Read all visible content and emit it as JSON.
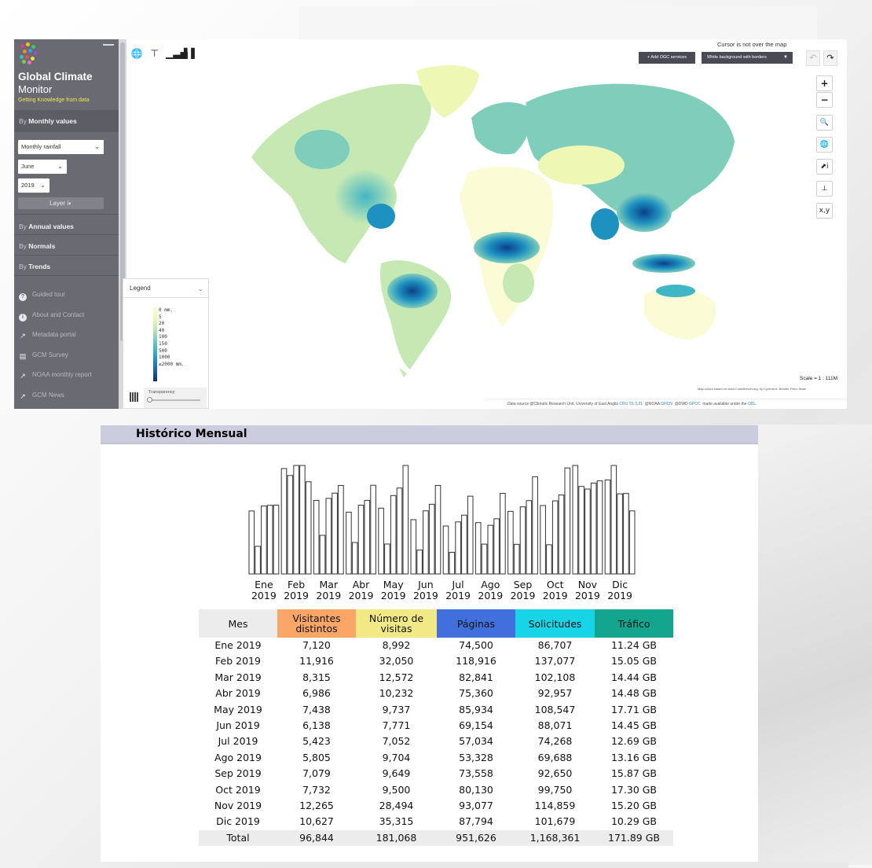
{
  "map_app": {
    "title": "Global Climate",
    "subtitle": "Monitor",
    "tagline": "Getting Knowledge from data",
    "sections": {
      "monthly": {
        "prefix": "By ",
        "label": "Monthly values"
      },
      "annual": {
        "prefix": "By ",
        "label": "Annual values"
      },
      "normals": {
        "prefix": "By ",
        "label": "Normals"
      },
      "trends": {
        "prefix": "By ",
        "label": "Trends"
      }
    },
    "variable_select": "Monthly rainfall",
    "month_select": "June",
    "year_select": "2019",
    "layer_button": "Layer",
    "links": [
      {
        "label": "Guided tour",
        "icon": "question-icon"
      },
      {
        "label": "About and Contact",
        "icon": "info-icon"
      },
      {
        "label": "Metadata portal",
        "icon": "external-link-icon"
      },
      {
        "label": "GCM Survey",
        "icon": "survey-icon"
      },
      {
        "label": "NOAA monthly report",
        "icon": "external-link-icon"
      },
      {
        "label": "GCM News",
        "icon": "external-link-icon"
      }
    ],
    "cursor_status": "Cursor is not over the map",
    "add_ogc_button": "+ Add OGC services",
    "background_select": "White background with borders",
    "legend": {
      "title": "Legend",
      "labels": [
        "0 mm.",
        "5",
        "20",
        "40",
        "100",
        "150",
        "500",
        "1000",
        "≥2000 mm."
      ],
      "transparency_label": "Transparency",
      "colors": [
        "#fbfbd6",
        "#eef8b4",
        "#c6e9b4",
        "#7fcdbb",
        "#41b6c4",
        "#1d91c0",
        "#225ea8",
        "#0c2c84"
      ]
    },
    "controls": {
      "zoom_in": "+",
      "zoom_out": "−",
      "xy": "x,y"
    },
    "scale": "Scale = 1 : 111M",
    "color_credit": "Map colors based on www.ColorBrewer.org, by Cynthia A. Brewer, Penn State",
    "attribution": {
      "prefix": "Data source:@Climatic Research Unit, University of East Anglia",
      "cru": "CRU TS 3.21",
      "noaa": "@NOAA",
      "ghcn": "GHCN",
      "dwd": "@DWD",
      "gpcc": "GPCC",
      "suffix": "made available under the",
      "odl": "ODL"
    }
  },
  "historico": {
    "title": "Histórico Mensual",
    "columns": [
      "Mes",
      "Visitantes distintos",
      "Número de visitas",
      "Páginas",
      "Solicitudes",
      "Tráfico"
    ],
    "rows": [
      {
        "mes": "Ene 2019",
        "visitantes": "7,120",
        "visitas": "8,992",
        "paginas": "74,500",
        "solicitudes": "86,707",
        "trafico": "11.24 GB"
      },
      {
        "mes": "Feb 2019",
        "visitantes": "11,916",
        "visitas": "32,050",
        "paginas": "118,916",
        "solicitudes": "137,077",
        "trafico": "15.05 GB"
      },
      {
        "mes": "Mar 2019",
        "visitantes": "8,315",
        "visitas": "12,572",
        "paginas": "82,841",
        "solicitudes": "102,108",
        "trafico": "14.44 GB"
      },
      {
        "mes": "Abr 2019",
        "visitantes": "6,986",
        "visitas": "10,232",
        "paginas": "75,360",
        "solicitudes": "92,957",
        "trafico": "14.48 GB"
      },
      {
        "mes": "May 2019",
        "visitantes": "7,438",
        "visitas": "9,737",
        "paginas": "85,934",
        "solicitudes": "108,547",
        "trafico": "17.71 GB"
      },
      {
        "mes": "Jun 2019",
        "visitantes": "6,138",
        "visitas": "7,771",
        "paginas": "69,154",
        "solicitudes": "88,071",
        "trafico": "14.45 GB"
      },
      {
        "mes": "Jul 2019",
        "visitantes": "5,423",
        "visitas": "7,052",
        "paginas": "57,034",
        "solicitudes": "74,268",
        "trafico": "12.69 GB"
      },
      {
        "mes": "Ago 2019",
        "visitantes": "5,805",
        "visitas": "9,704",
        "paginas": "53,328",
        "solicitudes": "69,688",
        "trafico": "13.16 GB"
      },
      {
        "mes": "Sep 2019",
        "visitantes": "7,079",
        "visitas": "9,649",
        "paginas": "73,558",
        "solicitudes": "92,650",
        "trafico": "15.87 GB"
      },
      {
        "mes": "Oct 2019",
        "visitantes": "7,732",
        "visitas": "9,500",
        "paginas": "80,130",
        "solicitudes": "99,750",
        "trafico": "17.30 GB"
      },
      {
        "mes": "Nov 2019",
        "visitantes": "12,265",
        "visitas": "28,494",
        "paginas": "93,077",
        "solicitudes": "114,859",
        "trafico": "15.20 GB"
      },
      {
        "mes": "Dic 2019",
        "visitantes": "10,627",
        "visitas": "35,315",
        "paginas": "87,794",
        "solicitudes": "101,679",
        "trafico": "10.29 GB"
      }
    ],
    "total": {
      "mes": "Total",
      "visitantes": "96,844",
      "visitas": "181,068",
      "paginas": "951,626",
      "solicitudes": "1,168,361",
      "trafico": "171.89 GB"
    },
    "header_colors": {
      "visitantes": "#f9a666",
      "visitas": "#f1e986",
      "paginas": "#4170dc",
      "solicitudes": "#17d4e6",
      "trafico": "#14a58e"
    }
  },
  "chart_data": {
    "type": "bar",
    "title": "",
    "categories": [
      [
        "Ene",
        "2019"
      ],
      [
        "Feb",
        "2019"
      ],
      [
        "Mar",
        "2019"
      ],
      [
        "Abr",
        "2019"
      ],
      [
        "May",
        "2019"
      ],
      [
        "Jun",
        "2019"
      ],
      [
        "Jul",
        "2019"
      ],
      [
        "Ago",
        "2019"
      ],
      [
        "Sep",
        "2019"
      ],
      [
        "Oct",
        "2019"
      ],
      [
        "Nov",
        "2019"
      ],
      [
        "Dic",
        "2019"
      ]
    ],
    "series": [
      {
        "values": [
          7120,
          11916,
          8315,
          6986,
          7438,
          6138,
          5423,
          5805,
          7079,
          7732,
          12265,
          10627
        ]
      },
      {
        "values": [
          8992,
          32050,
          12572,
          10232,
          9737,
          7771,
          7052,
          9704,
          9649,
          9500,
          28494,
          35315
        ]
      },
      {
        "values": [
          74500,
          118916,
          82841,
          75360,
          85934,
          69154,
          57034,
          53328,
          73558,
          80130,
          93077,
          87794
        ]
      },
      {
        "values": [
          86707,
          137077,
          102108,
          92957,
          108547,
          88071,
          74268,
          69688,
          92650,
          99750,
          114859,
          101679
        ]
      },
      {
        "values": [
          11.24,
          15.05,
          14.44,
          14.48,
          17.71,
          14.45,
          12.69,
          13.16,
          15.87,
          17.3,
          15.2,
          10.29
        ]
      }
    ],
    "grid": false,
    "legend": "none"
  }
}
